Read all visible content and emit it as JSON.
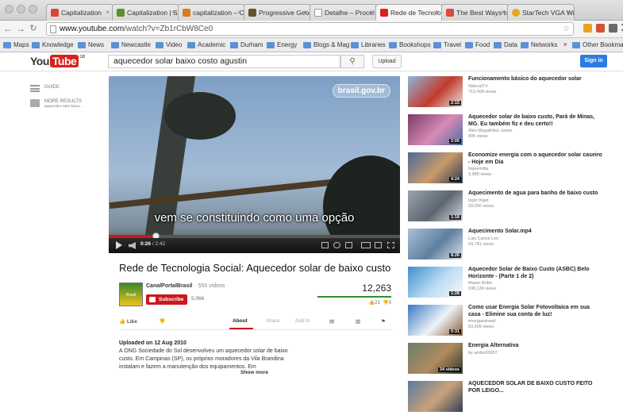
{
  "browser": {
    "tabs": [
      {
        "label": "Capitalization",
        "color": "#d8463a"
      },
      {
        "label": "Capitalization | Sn",
        "color": "#5c8f2b"
      },
      {
        "label": "capitalization – Co",
        "color": "#d67c1e"
      },
      {
        "label": "Progressive Geogr",
        "color": "#6a4f2a"
      },
      {
        "label": "Detalhe – Procel",
        "color": "#cfcfcf"
      },
      {
        "label": "Rede de Tecnolog",
        "color": "#d6221b"
      },
      {
        "label": "The Best Ways to S",
        "color": "#e04a3a"
      },
      {
        "label": "StarTech VGA Wi",
        "color": "#e7a81f"
      }
    ],
    "url_domain": "www.youtube.com",
    "url_path": "/watch?v=Zb1rCbW8Ce0",
    "bookmarks": [
      "Maps",
      "Knowledge",
      "News",
      "Newcastle",
      "Video",
      "Academic",
      "Durham",
      "Energy",
      "Blogs & Mag",
      "Libraries",
      "Bookshops",
      "Travel",
      "Food",
      "Data",
      "Networks",
      "Other Bookmarks"
    ],
    "bookmark_overflow": "»"
  },
  "youtube": {
    "logo_you": "You",
    "logo_tube": "Tube",
    "logo_locale": "GB",
    "search_query": "aquecedor solar baixo costo agustin",
    "upload_label": "Upload",
    "signin_label": "Sign in",
    "guide": {
      "guide_label": "GUIDE",
      "more_results_label": "MORE RESULTS",
      "more_results_sub": "aquecedor solar baixo..."
    }
  },
  "player": {
    "watermark": "brasil.gov.br",
    "subtitle": "vem se constituindo como uma opção",
    "current_time": "0:26",
    "duration": "2:42",
    "progress": 0.16
  },
  "video": {
    "title": "Rede de Tecnologia Social: Aquecedor solar de baixo custo",
    "channel_name": "CanalPortalBrasil",
    "channel_videos": "· 555 videos",
    "channel_thumb_text": "Brasil",
    "subscribe_label": "Subscribe",
    "subscriber_count": "5,066",
    "view_count": "12,263",
    "likes": "21",
    "dislikes": "0",
    "like_label": "Like",
    "tab_about": "About",
    "tab_share": "Share",
    "tab_addto": "Add to",
    "upload_date": "Uploaded on 12 Aug 2010",
    "description": "A ONG Sociedade do Sol desenvolveu um aquecedor solar de baixo custo. Em Campinas (SP), os próprios moradores da Vila Brandina instalam e fazem a manutenção dos equipamentos. Em",
    "show_more": "Show more"
  },
  "related": [
    {
      "title": "Funcionamento básico do aquecedor solar",
      "channel": "NaturalTV",
      "views": "713,408 views",
      "duration": "2:15",
      "colors": [
        "#8fb6dc",
        "#c23a2a",
        "#e8e8e8"
      ]
    },
    {
      "title": "Aquecedor solar de baixo custo, Pará de Minas, MG. Eu também fiz e deu certo!!",
      "channel": "Alex Magalhães Jaime",
      "views": "995 views",
      "duration": "2:05",
      "colors": [
        "#7a3e6a",
        "#d98ab6",
        "#4a6ca8"
      ]
    },
    {
      "title": "Economize energia com o aquecedor solar caseiro - Hoje em Dia",
      "channel": "hojeemdia",
      "views": "3,988 views",
      "duration": "4:24",
      "colors": [
        "#4b6a9a",
        "#c99a6a",
        "#283a52"
      ]
    },
    {
      "title": "Aquecimento de agua para banho de baixo custo",
      "channel": "login fnget",
      "views": "29,090 views",
      "duration": "1:18",
      "colors": [
        "#9aa5b0",
        "#5c6670",
        "#d9dde2"
      ]
    },
    {
      "title": "Aquecimento Solar.mp4",
      "channel": "Luis Carlos Leo",
      "views": "24,781 views",
      "duration": "8:26",
      "colors": [
        "#a8c0d8",
        "#5d7f9f",
        "#e0e6ec"
      ]
    },
    {
      "title": "Aquecedor Solar de Baixo Custo (ASBC) Belo Horizonte - (Parte 1 de 2)",
      "channel": "Mauro Britto",
      "views": "198,138 views",
      "duration": "1:28",
      "colors": [
        "#3f8fd0",
        "#bcdcf2",
        "#fafafa"
      ]
    },
    {
      "title": "Como usar Energia Solar Fotovoltaica em sua casa - Elimine sua conta de luz!",
      "channel": "energiaobrasil",
      "views": "63,609 views",
      "duration": "0:31",
      "colors": [
        "#3a78c2",
        "#eef3f8",
        "#8a5c3a"
      ]
    },
    {
      "title": "Energia Alternativa",
      "channel": "by andre20007",
      "views": "",
      "duration": "34 videos",
      "colors": [
        "#6a7f6a",
        "#b08a60",
        "#2d3a2d"
      ]
    },
    {
      "title": "AQUECEDOR SOLAR DE BAIXO CUSTO FEITO POR LEIGO...",
      "channel": "",
      "views": "",
      "duration": "",
      "colors": [
        "#5a7aa0",
        "#c9a27a",
        "#2f3f55"
      ]
    }
  ]
}
